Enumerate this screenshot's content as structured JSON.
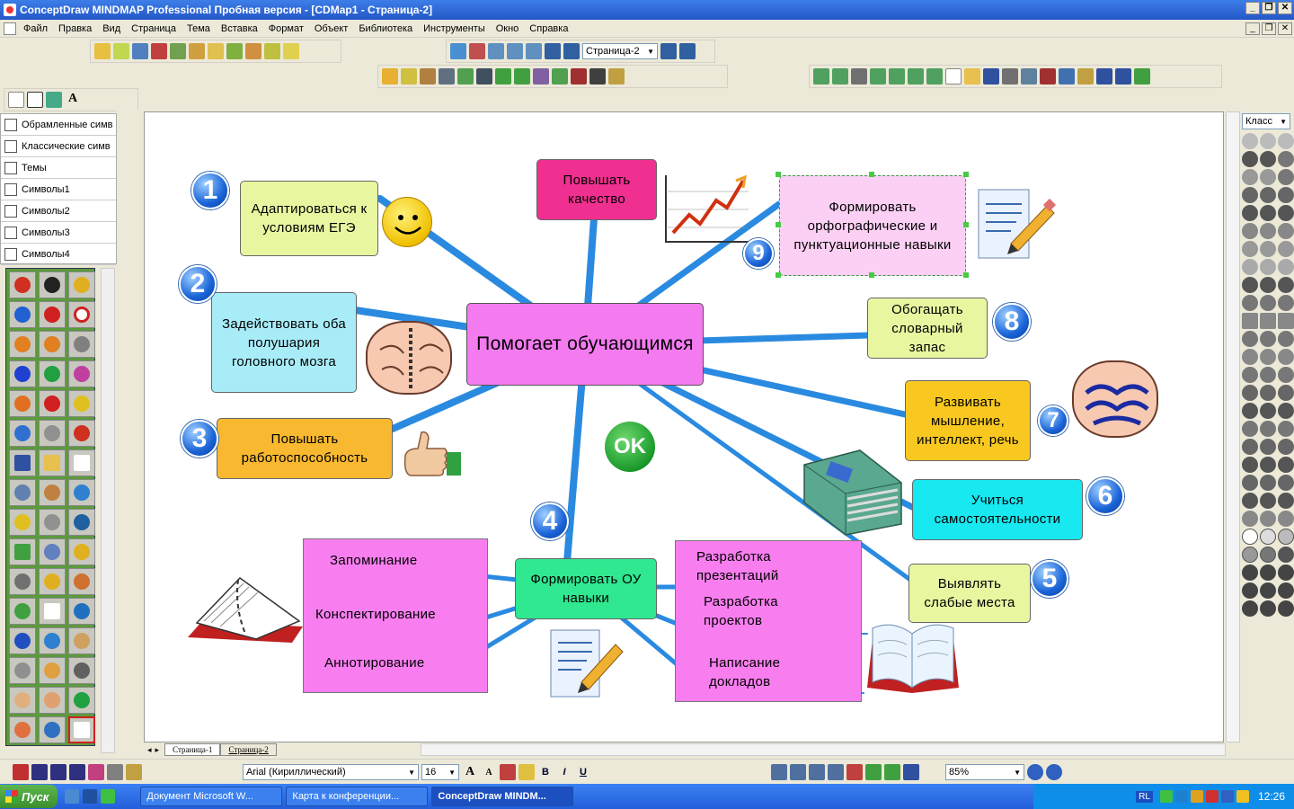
{
  "window": {
    "title": "ConceptDraw MINDMAP Professional Пробная версия - [CDMap1 - Страница-2]",
    "buttons": [
      "_",
      "❐",
      "✕"
    ]
  },
  "menu": [
    "Файл",
    "Правка",
    "Вид",
    "Страница",
    "Тема",
    "Вставка",
    "Формат",
    "Объект",
    "Библиотека",
    "Инструменты",
    "Окно",
    "Справка"
  ],
  "toolbar": {
    "page_select": "Страница-2",
    "zoom": "85%",
    "font": "Arial (Кириллический)",
    "font_size": "16",
    "bold": "B",
    "italic": "I",
    "underline": "U",
    "font_up": "A",
    "font_down": "A",
    "text_tool": "A"
  },
  "left_panel": {
    "items": [
      "Обрамленные симв",
      "Классические симв",
      "Темы",
      "Символы1",
      "Символы2",
      "Символы3",
      "Символы4"
    ]
  },
  "right_panel": {
    "class_select": "Класс"
  },
  "page_tabs": [
    "Страница-1",
    "Страница-2"
  ],
  "mindmap": {
    "center": "Помогает обучающимся",
    "ok_label": "OK",
    "branches": [
      {
        "num": "1",
        "text": "Адаптироваться к условиям ЕГЭ"
      },
      {
        "num": "2",
        "text": "Задействовать оба полушария головного мозга"
      },
      {
        "num": "3",
        "text": "Повышать работоспособность"
      },
      {
        "num": "4",
        "text": "Формировать ОУ навыки"
      },
      {
        "num": "5",
        "text": "Выявлять слабые места"
      },
      {
        "num": "6",
        "text": "Учиться самостоятельности"
      },
      {
        "num": "7",
        "text": "Развивать мышление, интеллект, речь"
      },
      {
        "num": "8",
        "text": "Обогащать словарный запас"
      },
      {
        "num": "9",
        "text": "Формировать орфографические и пунктуационные навыки"
      },
      {
        "num": "",
        "text": "Повышать качество"
      }
    ],
    "left_sub": [
      "Запоминание",
      "Конспектирование",
      "Аннотирование"
    ],
    "right_sub": [
      "Разработка презентаций",
      "Разработка проектов",
      "Написание докладов"
    ]
  },
  "taskbar": {
    "start": "Пуск",
    "tasks": [
      "Документ Microsoft W...",
      "Карта к конференции...",
      "ConceptDraw MINDM..."
    ],
    "tray_lang": "RL",
    "clock": "12:26"
  }
}
